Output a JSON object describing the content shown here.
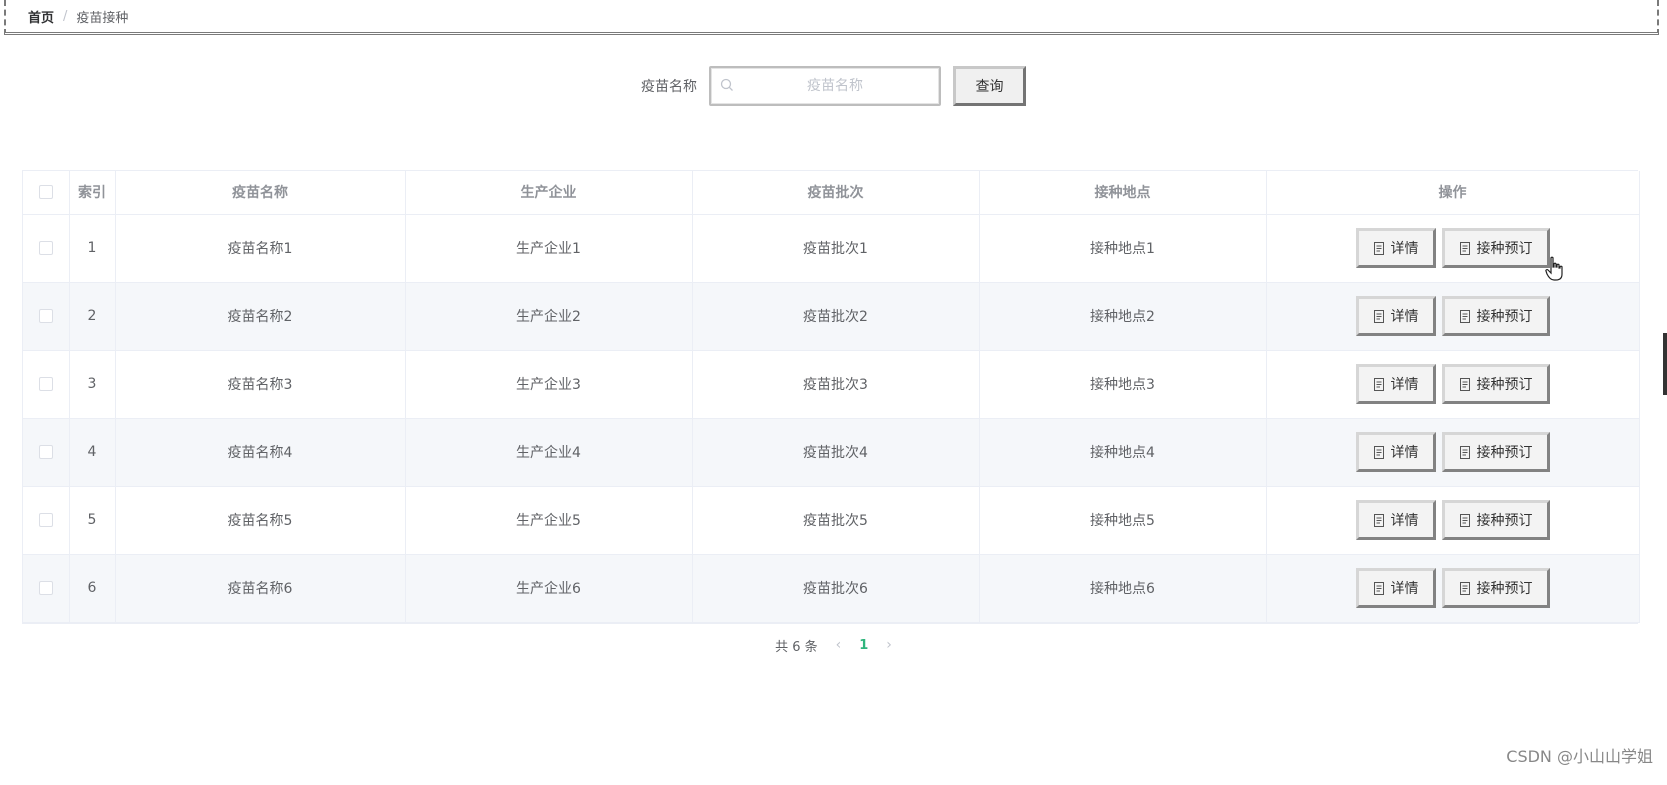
{
  "breadcrumb": {
    "home": "首页",
    "separator": "/",
    "current": "疫苗接种"
  },
  "search": {
    "label": "疫苗名称",
    "placeholder": "疫苗名称",
    "value": "",
    "button_label": "查询",
    "icon": "search-icon"
  },
  "table": {
    "headers": {
      "index": "索引",
      "name": "疫苗名称",
      "company": "生产企业",
      "batch": "疫苗批次",
      "location": "接种地点",
      "actions": "操作"
    },
    "rows": [
      {
        "index": "1",
        "name": "疫苗名称1",
        "company": "生产企业1",
        "batch": "疫苗批次1",
        "location": "接种地点1"
      },
      {
        "index": "2",
        "name": "疫苗名称2",
        "company": "生产企业2",
        "batch": "疫苗批次2",
        "location": "接种地点2"
      },
      {
        "index": "3",
        "name": "疫苗名称3",
        "company": "生产企业3",
        "batch": "疫苗批次3",
        "location": "接种地点3"
      },
      {
        "index": "4",
        "name": "疫苗名称4",
        "company": "生产企业4",
        "batch": "疫苗批次4",
        "location": "接种地点4"
      },
      {
        "index": "5",
        "name": "疫苗名称5",
        "company": "生产企业5",
        "batch": "疫苗批次5",
        "location": "接种地点5"
      },
      {
        "index": "6",
        "name": "疫苗名称6",
        "company": "生产企业6",
        "batch": "疫苗批次6",
        "location": "接种地点6"
      }
    ],
    "actions": {
      "detail_label": "详情",
      "book_label": "接种预订",
      "icon": "document-icon"
    }
  },
  "pagination": {
    "total_text": "共 6 条",
    "current_page": "1",
    "prev": "‹",
    "next": "›"
  },
  "watermark": "CSDN @小山山学姐",
  "colors": {
    "accent": "#2fb57c",
    "header_text": "#909399",
    "body_text": "#606266",
    "stripe": "#f5f7fa"
  }
}
